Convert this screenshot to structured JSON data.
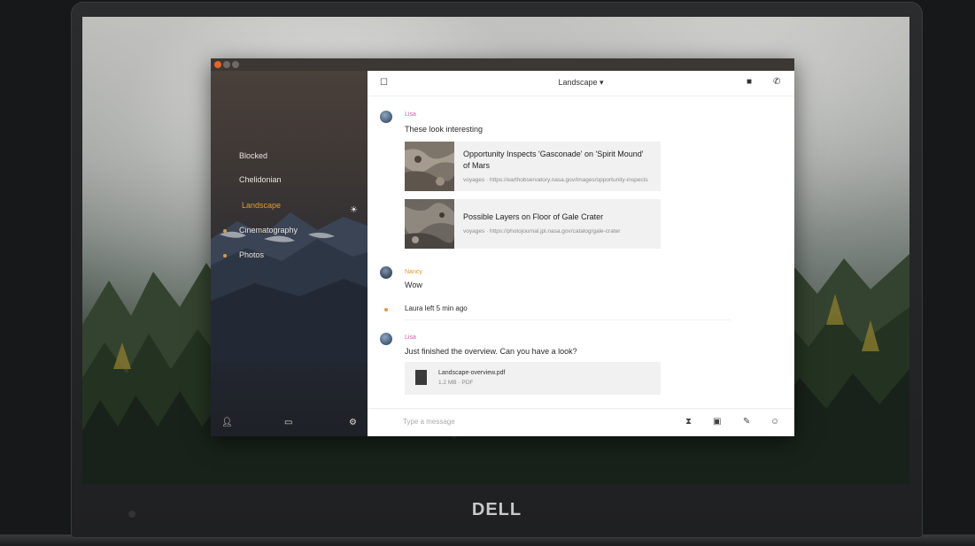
{
  "device": {
    "brand": "DELL"
  },
  "window": {
    "titlebar_buttons": [
      "close",
      "minimize",
      "maximize"
    ]
  },
  "sidebar": {
    "items": [
      {
        "label": "Blocked",
        "active": false,
        "dot": false
      },
      {
        "label": "Chelidonian",
        "active": false,
        "dot": false
      },
      {
        "label": "Landscape",
        "active": true,
        "dot": false
      },
      {
        "label": "Cinematography",
        "active": false,
        "dot": true
      },
      {
        "label": "Photos",
        "active": false,
        "dot": true
      }
    ],
    "weather_icon": "sun-icon",
    "bottom_icons": [
      "user-icon",
      "grid-icon",
      "settings-icon"
    ]
  },
  "chat": {
    "header": {
      "title": "Landscape ▾",
      "menu_icon": "menu-icon",
      "video_icon": "video-icon",
      "phone_icon": "phone-icon"
    },
    "messages": [
      {
        "sender": "Lisa",
        "sender_color": "#e05aa0",
        "text": "These look interesting",
        "links": [
          {
            "title": "Opportunity Inspects 'Gasconade' on 'Spirit Mound' of Mars",
            "url": "voyages · https://earthobservatory.nasa.gov/images/opportunity-inspects"
          },
          {
            "title": "Possible Layers on Floor of Gale Crater",
            "url": "voyages · https://photojournal.jpl.nasa.gov/catalog/gale-crater"
          }
        ]
      },
      {
        "sender": "Nancy",
        "sender_color": "#e39a35",
        "text": "Wow"
      },
      {
        "system": true,
        "text": "Laura left 5 min ago"
      },
      {
        "sender": "Lisa",
        "sender_color": "#e05aa0",
        "text": "Just finished the overview. Can you have a look?",
        "file": {
          "name": "Landscape-overview.pdf",
          "meta": "1.2 MB · PDF"
        }
      }
    ],
    "composer": {
      "placeholder": "Type a message",
      "icons": [
        "timer-icon",
        "image-icon",
        "attach-icon",
        "emoji-icon"
      ]
    }
  }
}
